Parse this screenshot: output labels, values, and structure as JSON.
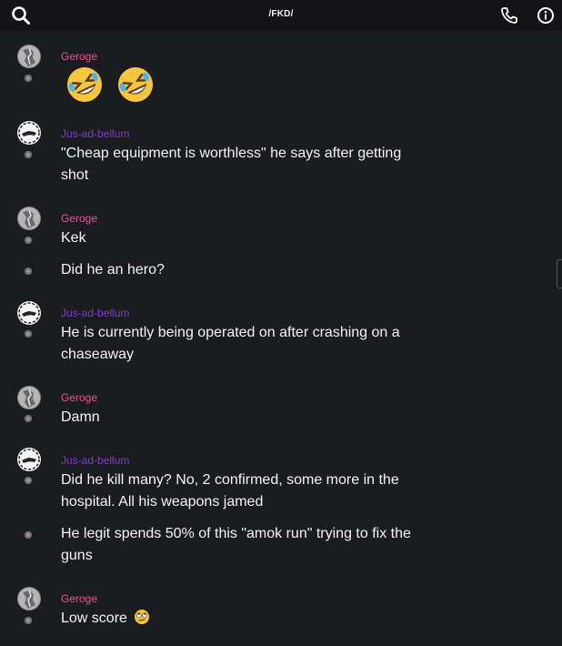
{
  "header": {
    "title": "/FKD/",
    "icons": {
      "left": "search-icon",
      "right": [
        "phone-icon",
        "info-icon"
      ]
    }
  },
  "users": {
    "geroge": {
      "name": "Geroge",
      "color": "#e0569e"
    },
    "jus": {
      "name": "Jus-ad-bellum",
      "color": "#7a3fc4"
    }
  },
  "messages": {
    "m1_emojis": [
      "rolling-on-floor-laughing",
      "rolling-on-floor-laughing"
    ],
    "m2": "\"Cheap equipment is worthless\" he says after getting shot",
    "m3": "Kek",
    "m4": "Did he an hero?",
    "m5": "He is currently being operated on after crashing on a chaseaway",
    "m6": "Damn",
    "m7": "Did he kill many? No, 2 confirmed, some more in the hospital. All his weapons jamed",
    "m8": "He legit spends 50% of this \"amok run\" trying to fix the guns",
    "m9": "Low score",
    "m9_emoji": "eye-roll-face"
  }
}
